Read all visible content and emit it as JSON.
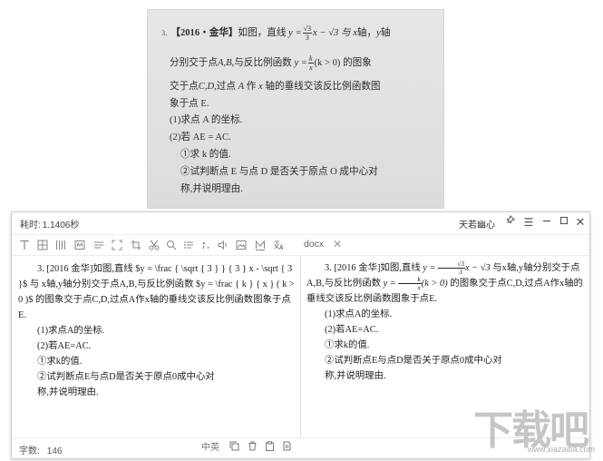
{
  "photo": {
    "num": "3.",
    "tag": "【2016・金华】",
    "l1a": "如图，直线",
    "l1_y": "y =",
    "l1_frac_n": "√3",
    "l1_frac_d": "3",
    "l1b": "x − √3 与",
    "l1_x": "x",
    "l1c": "轴，",
    "l1_y2": "y",
    "l1d": "轴",
    "l2a": "分别交于点",
    "l2_ab": "A,B,",
    "l2b": "与反比例函数",
    "l2_y": "y =",
    "l2_frac_n": "k",
    "l2_frac_d": "x",
    "l2c": "(k > 0) 的图象",
    "l3a": "交于点",
    "l3_cd": "C,D,",
    "l3b": "过点",
    "l3_a": "A",
    "l3c": "作",
    "l3_x": "x",
    "l3d": "轴的垂线交该反比例函数图",
    "l4": "象于点 E.",
    "l5": "(1)求点 A 的坐标.",
    "l6": "(2)若 AE = AC.",
    "l7": "①求 k 的值.",
    "l8": "②试判断点 E 与点 D 是否关于原点 O 成中心对",
    "l9": "称,并说明理由."
  },
  "window": {
    "elapsed_label": "耗时:",
    "elapsed_value": "1.1406秒",
    "brand": "天若幽心",
    "toolbar": {
      "docx_tab": "docx"
    },
    "left_pane": {
      "p1": "3. [2016 金华]如图,直线 $y = \\frac { \\sqrt { 3 } } { 3 } x - \\sqrt { 3 }$ 与 x轴,y轴分别交于点A,B,与反比例函数 $y = \\frac { k } { x } ( k > 0 )$ 的图象交于点C,D,过点A作x轴的垂线交该反比例函数图象于点E.",
      "l2": "(1)求点A的坐标.",
      "l3": "(2)若AE=AC.",
      "l4": "①求k的值.",
      "l5": "②试判断点E与点D是否关于原点0成中心对",
      "l6": "称,并说明理由."
    },
    "right_pane": {
      "p1a": "3. [2016 金华]如图,直线",
      "p1_y": "y =",
      "p1_fn": "√3",
      "p1_fd": "3",
      "p1_b": "x − √3",
      "p1_c": "与x轴,y轴分别交于点A,B,与反比例函数",
      "p1_y2": "y =",
      "p1_fn2": "k",
      "p1_fd2": "x",
      "p1_d": "(k > 0)",
      "p1_e": "的图象交于点C,D,过点A作x轴的垂线交该反比例函数图象于点E.",
      "l2": "(1)求点A的坐标.",
      "l3": "(2)若AE=AC.",
      "l4": "①求k的值.",
      "l5": "②试判断点E与点D是否关于原点0成中心对",
      "l6": "称,并说明理由."
    },
    "status": {
      "count_label": "字数:",
      "count_value": "146",
      "lang_label": "中英"
    }
  },
  "watermark": {
    "text": "下载吧",
    "sub": "www.xiazaiba.com"
  }
}
